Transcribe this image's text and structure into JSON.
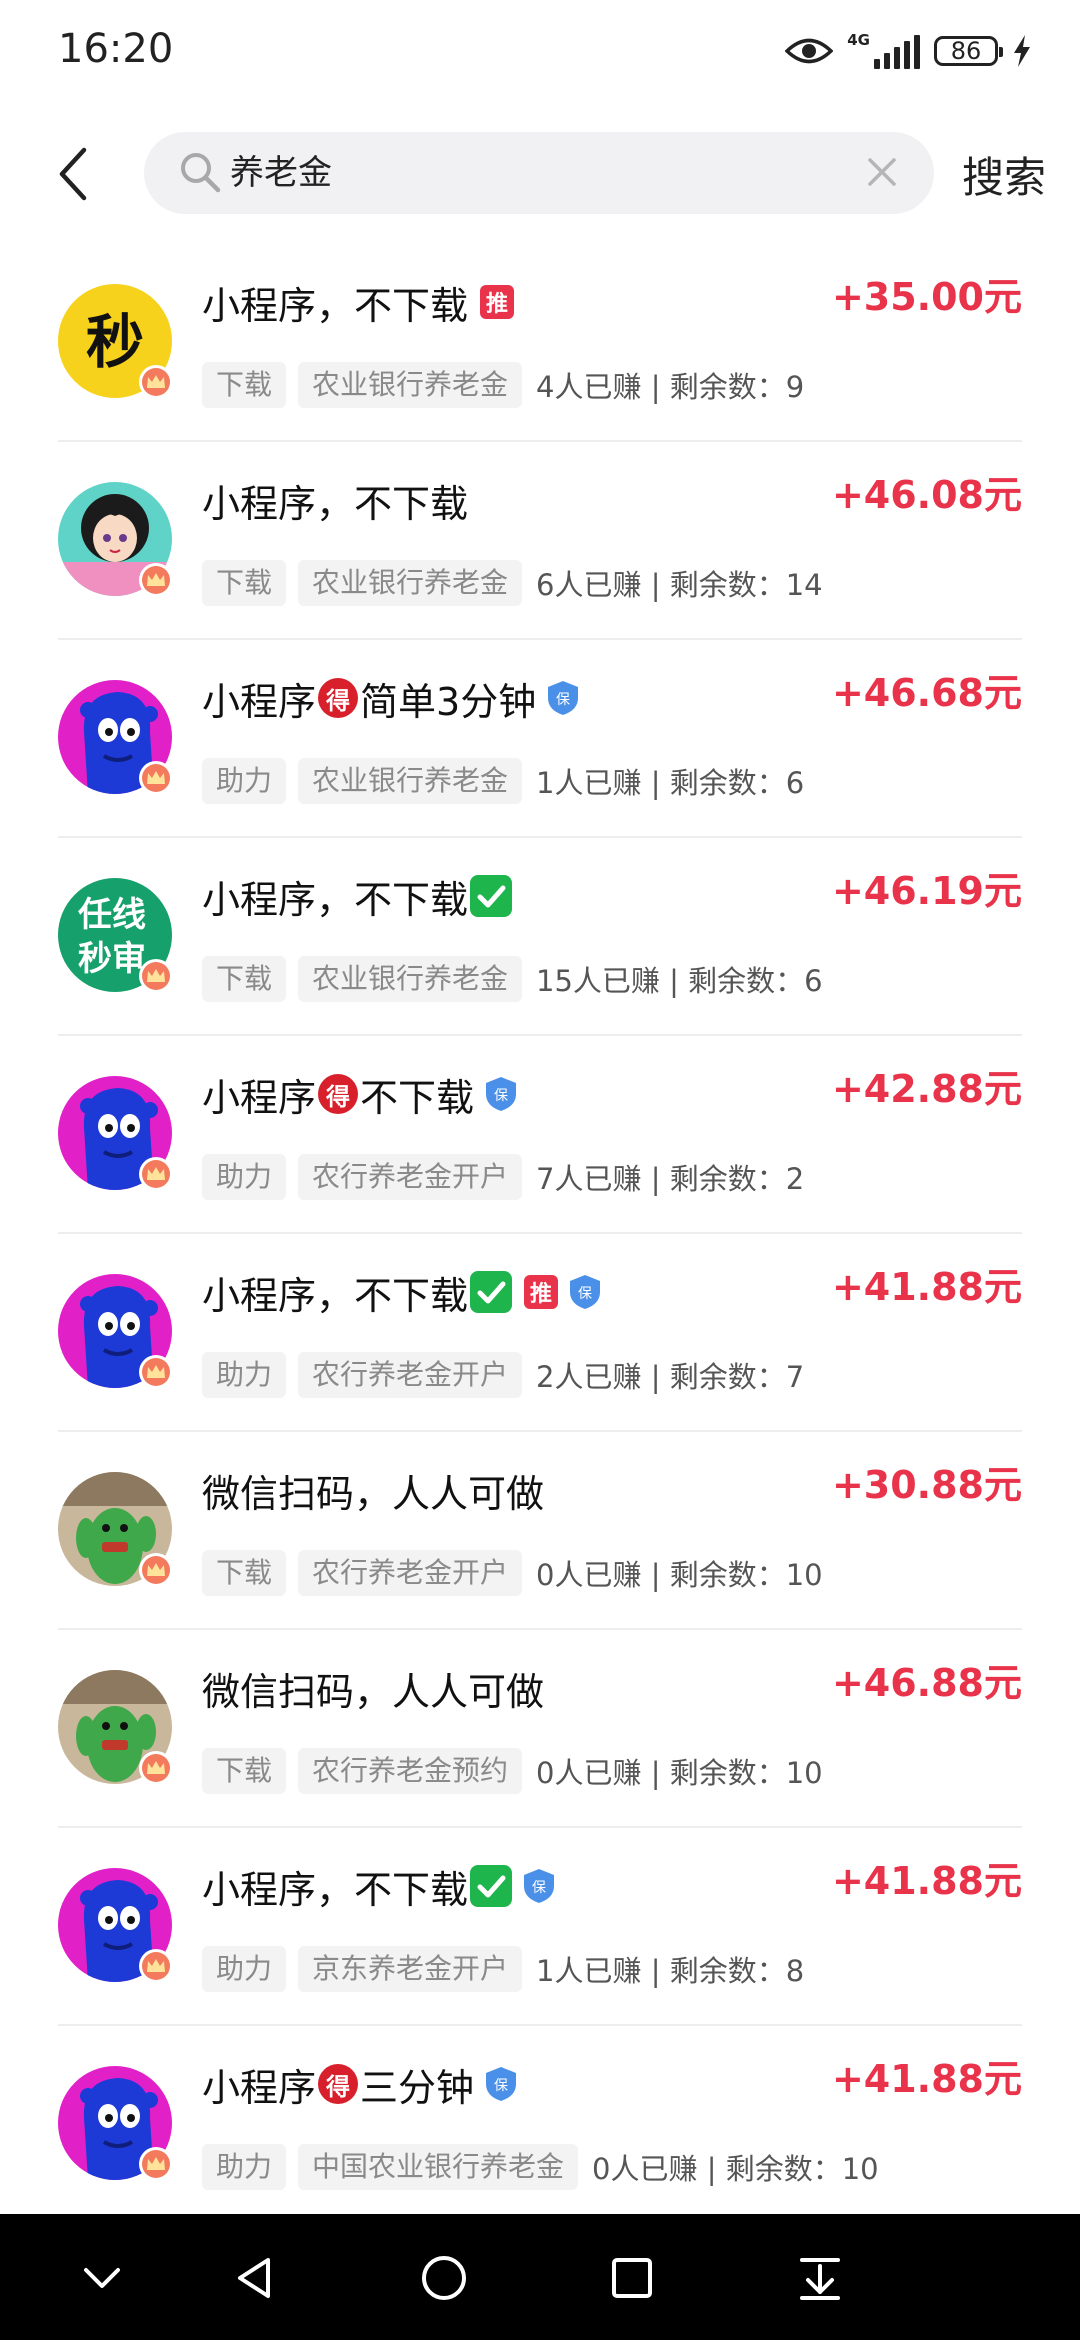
{
  "status_bar": {
    "time": "16:20",
    "network_label": "4G",
    "battery": "86"
  },
  "search": {
    "query": "养老金",
    "button_label": "搜索"
  },
  "items": [
    {
      "title": "小程序，不下载",
      "badges": [
        "推"
      ],
      "avatar": "miao",
      "reward": "+35.00元",
      "type_tag": "下载",
      "bank_tag": "农业银行养老金",
      "stats": "4人已赚 | 剩余数：9"
    },
    {
      "title": "小程序，不下载",
      "badges": [],
      "avatar": "anime",
      "reward": "+46.08元",
      "type_tag": "下载",
      "bank_tag": "农业银行养老金",
      "stats": "6人已赚 | 剩余数：14"
    },
    {
      "title_a": "小程序",
      "title_b": "简单3分钟",
      "badge_mid": "得",
      "badges": [
        "保"
      ],
      "avatar": "blue-monster",
      "reward": "+46.68元",
      "type_tag": "助力",
      "bank_tag": "农业银行养老金",
      "stats": "1人已赚 | 剩余数：6"
    },
    {
      "title": "小程序，不下载",
      "badges": [
        "check"
      ],
      "avatar": "green-text",
      "avatar_text_1": "任线",
      "avatar_text_2": "秒审",
      "reward": "+46.19元",
      "type_tag": "下载",
      "bank_tag": "农业银行养老金",
      "stats": "15人已赚 | 剩余数：6"
    },
    {
      "title_a": "小程序",
      "title_b": "不下载",
      "badge_mid": "得",
      "badges": [
        "保"
      ],
      "avatar": "blue-monster",
      "reward": "+42.88元",
      "type_tag": "助力",
      "bank_tag": "农行养老金开户",
      "stats": "7人已赚 | 剩余数：2"
    },
    {
      "title": "小程序，不下载",
      "badges": [
        "check",
        "推",
        "保"
      ],
      "avatar": "blue-monster",
      "reward": "+41.88元",
      "type_tag": "助力",
      "bank_tag": "农行养老金开户",
      "stats": "2人已赚 | 剩余数：7"
    },
    {
      "title": "微信扫码，人人可做",
      "badges": [],
      "avatar": "cactus",
      "reward": "+30.88元",
      "type_tag": "下载",
      "bank_tag": "农行养老金开户",
      "stats": "0人已赚 | 剩余数：10"
    },
    {
      "title": "微信扫码，人人可做",
      "badges": [],
      "avatar": "cactus",
      "reward": "+46.88元",
      "type_tag": "下载",
      "bank_tag": "农行养老金预约",
      "stats": "0人已赚 | 剩余数：10"
    },
    {
      "title": "小程序，不下载",
      "badges": [
        "check",
        "保"
      ],
      "avatar": "blue-monster",
      "reward": "+41.88元",
      "type_tag": "助力",
      "bank_tag": "京东养老金开户",
      "stats": "1人已赚 | 剩余数：8"
    },
    {
      "title_a": "小程序",
      "title_b": "三分钟",
      "badge_mid": "得",
      "badges": [
        "保"
      ],
      "avatar": "blue-monster",
      "reward": "+41.88元",
      "type_tag": "助力",
      "bank_tag": "中国农业银行养老金",
      "stats": "0人已赚 | 剩余数：10"
    }
  ],
  "icons": {
    "status": [
      "eye-icon",
      "signal-icon",
      "battery-icon",
      "charging-icon"
    ],
    "header": [
      "back-arrow-icon",
      "search-icon",
      "clear-icon"
    ],
    "nav": [
      "collapse-icon",
      "back-triangle-icon",
      "home-circle-icon",
      "recents-square-icon",
      "download-icon"
    ]
  },
  "colors": {
    "accent": "#e8334a",
    "tag_bg": "#f3f3f3",
    "tag_text": "#8a8a8a",
    "check_green": "#1fb54d",
    "shield_blue": "#4b90e8"
  }
}
